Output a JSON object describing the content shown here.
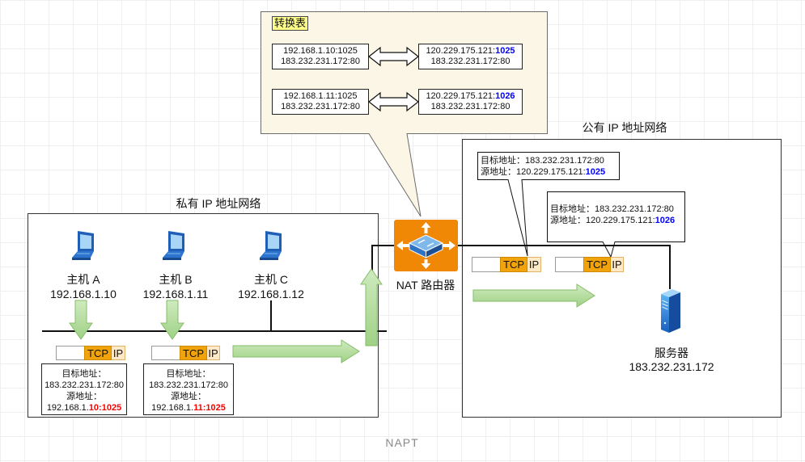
{
  "caption": "NAPT",
  "translation_table": {
    "title": "转换表",
    "rows": [
      {
        "private_src": "192.168.1.10:1025",
        "private_dst": "183.232.231.172:80",
        "public_src_prefix": "120.229.175.121:",
        "public_src_port": "1025",
        "public_dst": "183.232.231.172:80"
      },
      {
        "private_src": "192.168.1.11:1025",
        "private_dst": "183.232.231.172:80",
        "public_src_prefix": "120.229.175.121:",
        "public_src_port": "1026",
        "public_dst": "183.232.231.172:80"
      }
    ]
  },
  "private_network": {
    "label": "私有 IP 地址网络",
    "hosts": [
      {
        "icon": "laptop-icon",
        "name": "主机 A",
        "ip": "192.168.1.10"
      },
      {
        "icon": "laptop-icon",
        "name": "主机 B",
        "ip": "192.168.1.11"
      },
      {
        "icon": "laptop-icon",
        "name": "主机 C",
        "ip": "192.168.1.12"
      }
    ],
    "packets": [
      {
        "tcp_header": "TCP",
        "ip_header": "IP",
        "dst_label": "目标地址：",
        "dst": "183.232.231.172:80",
        "src_label": "源地址：",
        "src_prefix": "192.168.1.",
        "src_highlight": "10:1025"
      },
      {
        "tcp_header": "TCP",
        "ip_header": "IP",
        "dst_label": "目标地址：",
        "dst": "183.232.231.172:80",
        "src_label": "源地址：",
        "src_prefix": "192.168.1.",
        "src_highlight": "11:1025"
      }
    ]
  },
  "router": {
    "icon": "router-icon",
    "label": "NAT 路由器"
  },
  "public_network": {
    "label": "公有 IP 地址网络",
    "packets": [
      {
        "tcp_header": "TCP",
        "ip_header": "IP",
        "dst_label": "目标地址：",
        "dst": "183.232.231.172:80",
        "src_label": "源地址：",
        "src_prefix": "120.229.175.121:",
        "src_highlight": "1025"
      },
      {
        "tcp_header": "TCP",
        "ip_header": "IP",
        "dst_label": "目标地址：",
        "dst": "183.232.231.172:80",
        "src_label": "源地址：",
        "src_prefix": "120.229.175.121:",
        "src_highlight": "1026"
      }
    ],
    "server": {
      "icon": "server-icon",
      "name": "服务器",
      "ip": "183.232.231.172"
    }
  },
  "colors": {
    "table_fill": "#fcf6e6",
    "table_title_fill": "#ffff88",
    "tcp_fill": "#f0a30a",
    "ip_fill": "#ffe9c7",
    "arrow_green_light": "#cfebbf",
    "arrow_green_dark": "#9fd185",
    "arrow_green_stroke": "#86bc69",
    "private_port_highlight": "#ff0000",
    "public_port_highlight": "#0000ff",
    "router_fill": "#f08705"
  }
}
